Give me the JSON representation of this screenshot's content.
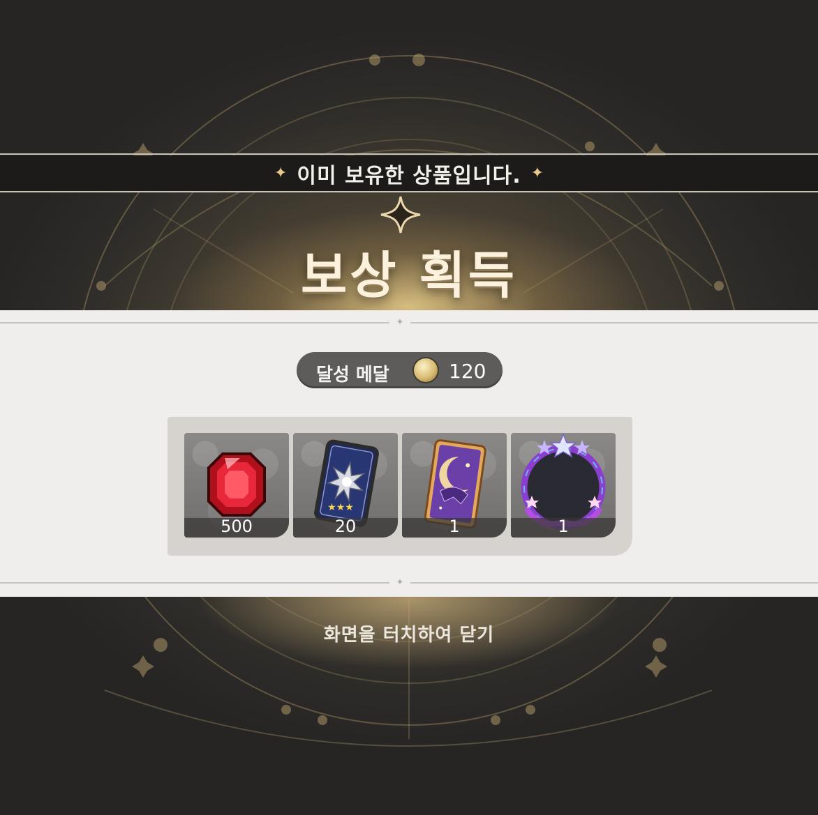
{
  "notice": {
    "text": "이미 보유한 상품입니다."
  },
  "title": "보상 획득",
  "medal": {
    "label": "달성 메달",
    "value": "120",
    "icon": "medal-icon"
  },
  "rewards": [
    {
      "name": "red-gem",
      "icon": "red-gem-icon",
      "quantity": "500"
    },
    {
      "name": "star-card",
      "icon": "navy-card-icon",
      "quantity": "20"
    },
    {
      "name": "moon-card",
      "icon": "moon-card-icon",
      "quantity": "1"
    },
    {
      "name": "profile-frame",
      "icon": "star-frame-icon",
      "quantity": "1"
    }
  ],
  "close_hint": "화면을 터치하여 닫기",
  "colors": {
    "panel": "#efeeec",
    "banner": "#1c1b1a",
    "gold": "#e8c989"
  }
}
